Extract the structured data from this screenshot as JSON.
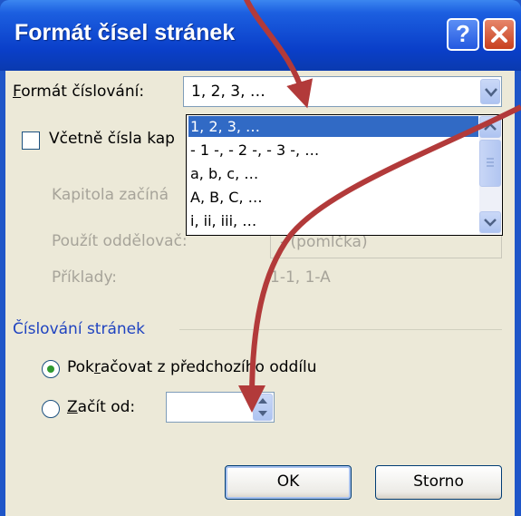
{
  "dialog": {
    "title": "Formát čísel stránek",
    "help_label": "?",
    "close_label": "×"
  },
  "numbering_format": {
    "label_accel": "F",
    "label_rest": "ormát číslování:",
    "selected": "1, 2, 3, …",
    "options": [
      "1, 2, 3, …",
      "- 1 -, - 2 -, - 3 -, …",
      "a, b, c, …",
      "A, B, C, …",
      "i, ii, iii, …"
    ]
  },
  "chapter": {
    "include_label_visible": "Včetně čísla kap",
    "include_checked": false,
    "starts_with_label": "Kapitola začíná",
    "separator_label": "Použít oddělovač:",
    "separator_value": "-   (pomlčka)",
    "examples_label": "Příklady:",
    "examples_value": "1-1, 1-A"
  },
  "page_numbering": {
    "section_title": "Číslování stránek",
    "continue_label_pre": "Pok",
    "continue_label_accel": "r",
    "continue_label_post": "ačovat z předchozího oddílu",
    "continue_selected": true,
    "start_at_label_accel": "Z",
    "start_at_label_rest": "ačít od:",
    "start_at_value": ""
  },
  "buttons": {
    "ok": "OK",
    "cancel": "Storno"
  },
  "colors": {
    "title_bar": "#0a3fc9",
    "selection": "#316ac5",
    "annotation_arrow": "#b23a3a"
  }
}
